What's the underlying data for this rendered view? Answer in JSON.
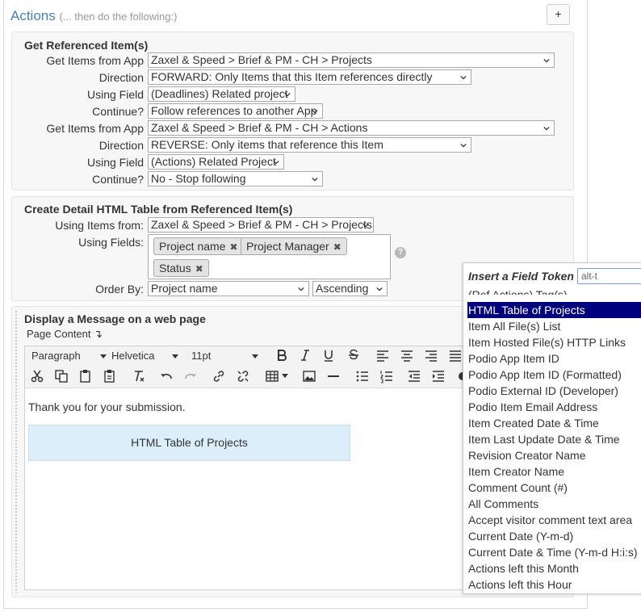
{
  "actions": {
    "title": "Actions",
    "subtitle": "(... then do the following:)",
    "add_label": "+"
  },
  "get_ref": {
    "title": "Get Referenced Item(s)",
    "rows": [
      {
        "label": "Get Items from App",
        "value": "Zaxel & Speed > Brief & PM - CH > Projects"
      },
      {
        "label": "Direction",
        "value": "FORWARD: Only Items that this Item references directly"
      },
      {
        "label": "Using Field",
        "value": "(Deadlines) Related project"
      },
      {
        "label": "Continue?",
        "value": "Follow references to another App"
      },
      {
        "label": "Get Items from App",
        "value": "Zaxel & Speed > Brief & PM - CH > Actions"
      },
      {
        "label": "Direction",
        "value": "REVERSE: Only items that reference this Item"
      },
      {
        "label": "Using Field",
        "value": "(Actions) Related Project"
      },
      {
        "label": "Continue?",
        "value": "No - Stop following"
      }
    ]
  },
  "create_table": {
    "title": "Create Detail HTML Table from Referenced Item(s)",
    "using_items_label": "Using Items from:",
    "using_items_value": "Zaxel & Speed > Brief & PM - CH > Projects",
    "using_fields_label": "Using Fields:",
    "fields": [
      "Project name",
      "Project Manager",
      "Status"
    ],
    "remove_glyph": "✖",
    "help_glyph": "?",
    "order_by_label": "Order By:",
    "order_by_value": "Project name",
    "order_dir_value": "Ascending"
  },
  "display": {
    "title": "Display a Message on a web page",
    "page_content_label": "Page Content",
    "page_content_arrow": "↴",
    "toolbar": {
      "format": "Paragraph",
      "font": "Helvetica",
      "size": "11pt"
    },
    "body_text": "Thank you for your submission.",
    "table_token": "HTML Table of Projects"
  },
  "token_popup": {
    "title": "Insert a Field Token",
    "search_value": "alt-t",
    "partial_item": "(Ref Actions) Tag(s)",
    "items": [
      "HTML Table of Projects",
      "Item All File(s) List",
      "Item Hosted File(s) HTTP Links",
      "Podio App Item ID",
      "Podio App Item ID (Formatted)",
      "Podio External ID (Developer)",
      "Podio Item Email Address",
      "Item Created Date & Time",
      "Item Last Update Date & Time",
      "Revision Creator Name",
      "Item Creator Name",
      "Comment Count (#)",
      "All Comments",
      "Accept visitor comment text area",
      "Current Date (Y-m-d)",
      "Current Date & Time (Y-m-d H:i:s)",
      "Actions left this Month",
      "Actions left this Hour"
    ]
  },
  "colors": {
    "accent": "#4a7fb5",
    "selection": "#00007f",
    "token_bg": "#ddeefb"
  }
}
